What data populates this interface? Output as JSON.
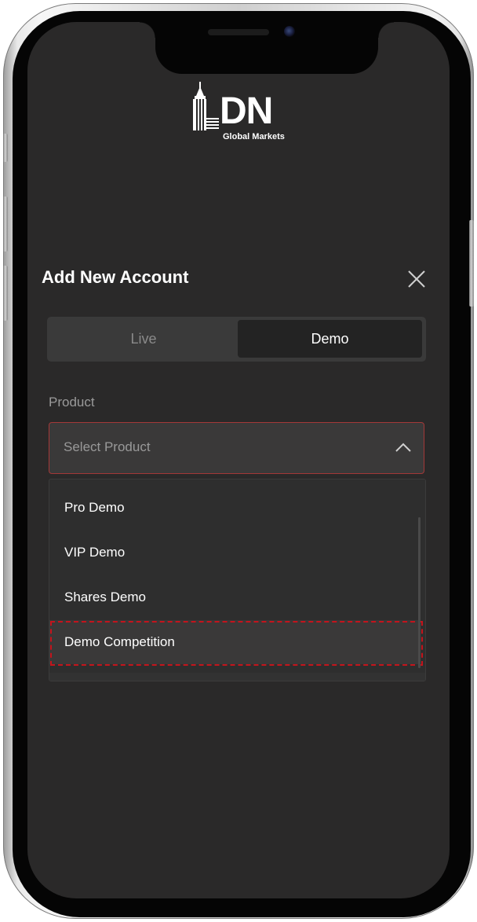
{
  "brand": {
    "logo_text": "DN",
    "logo_subtitle": "Global Markets"
  },
  "sheet": {
    "title": "Add New Account",
    "close_icon": "close-icon"
  },
  "tabs": [
    {
      "label": "Live",
      "active": false
    },
    {
      "label": "Demo",
      "active": true
    }
  ],
  "product": {
    "label": "Product",
    "placeholder": "Select Product",
    "expanded": true,
    "chevron_icon": "chevron-up-icon",
    "options": [
      "Pro Demo",
      "VIP Demo",
      "Shares Demo",
      "Demo Competition"
    ],
    "highlighted_option": "Demo Competition"
  },
  "colors": {
    "screen_bg": "#2a2929",
    "accent_border": "#a33838",
    "highlight_dash": "#c4141c",
    "text_primary": "#ffffff",
    "text_muted": "#9a9a9a"
  }
}
